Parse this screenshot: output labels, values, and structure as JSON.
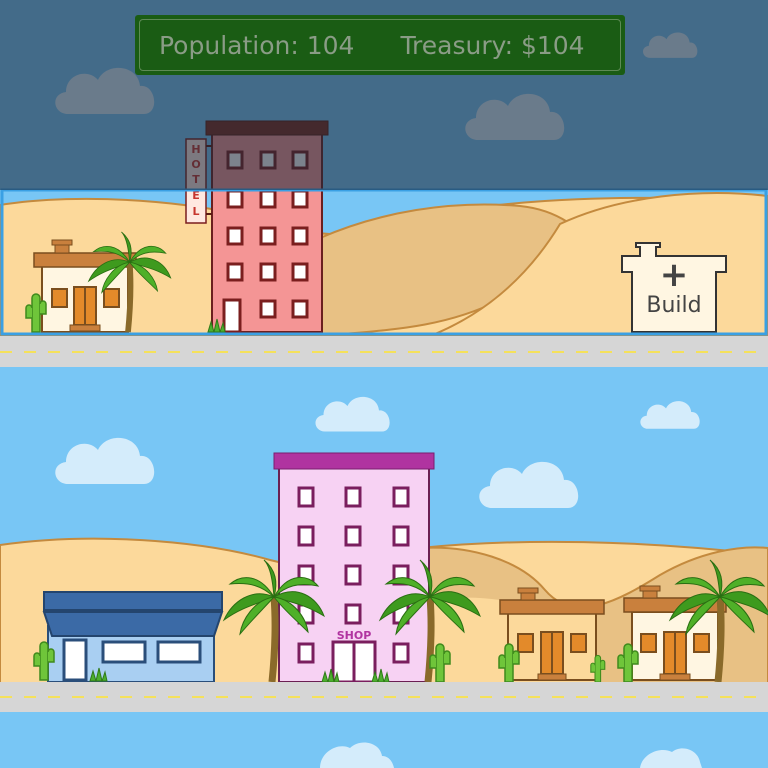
{
  "hud": {
    "population_label": "Population: 104",
    "treasury_label": "Treasury: $104"
  },
  "buildings": {
    "hotel_sign": [
      "H",
      "O",
      "T",
      "E",
      "L"
    ],
    "shop_sign": "SHOP"
  },
  "build_button": {
    "icon": "plus-icon",
    "label": "Build"
  },
  "colors": {
    "sky": "#78c6f5",
    "sand": "#fcd99b",
    "road": "#d6d6d6",
    "hud_bg": "#1a5c14",
    "selection_border": "#3aa0e4"
  }
}
